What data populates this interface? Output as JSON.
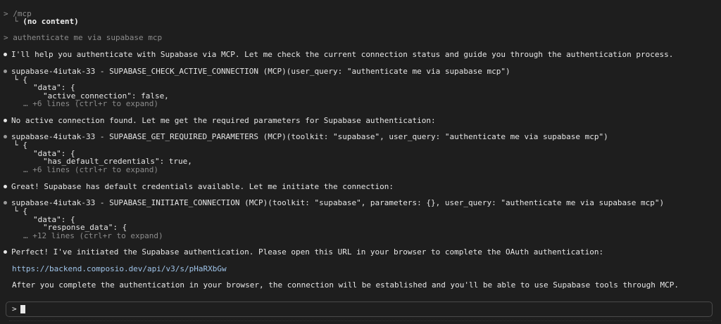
{
  "history": {
    "cmd1": "> /mcp",
    "cmd1_result_prefix": "└ ",
    "cmd1_result": "(no content)",
    "cmd2": "> authenticate me via supabase mcp"
  },
  "messages": {
    "m1": "I'll help you authenticate with Supabase via MCP. Let me check the current connection status and guide you through the authentication process.",
    "t1": "supabase-4iutak-33 - SUPABASE_CHECK_ACTIVE_CONNECTION (MCP)(user_query: \"authenticate me via supabase mcp\")",
    "t1_l1": "└ {",
    "t1_l2": "\"data\": {",
    "t1_l3": "\"active_connection\": false,",
    "t1_more": "… +6 lines (ctrl+r to expand)",
    "m2": "No active connection found. Let me get the required parameters for Supabase authentication:",
    "t2": "supabase-4iutak-33 - SUPABASE_GET_REQUIRED_PARAMETERS (MCP)(toolkit: \"supabase\", user_query: \"authenticate me via supabase mcp\")",
    "t2_l1": "└ {",
    "t2_l2": "\"data\": {",
    "t2_l3": "\"has_default_credentials\": true,",
    "t2_more": "… +6 lines (ctrl+r to expand)",
    "m3": "Great! Supabase has default credentials available. Let me initiate the connection:",
    "t3": "supabase-4iutak-33 - SUPABASE_INITIATE_CONNECTION (MCP)(toolkit: \"supabase\", parameters: {}, user_query: \"authenticate me via supabase mcp\")",
    "t3_l1": "└ {",
    "t3_l2": "\"data\": {",
    "t3_l3": "\"response_data\": {",
    "t3_more": "… +12 lines (ctrl+r to expand)",
    "m4": "Perfect! I've initiated the Supabase authentication. Please open this URL in your browser to complete the OAuth authentication:",
    "url": "https://backend.composio.dev/api/v3/s/pHaRXbGw",
    "m5": "After you complete the authentication in your browser, the connection will be established and you'll be able to use Supabase tools through MCP."
  },
  "input": {
    "prompt": ">"
  }
}
